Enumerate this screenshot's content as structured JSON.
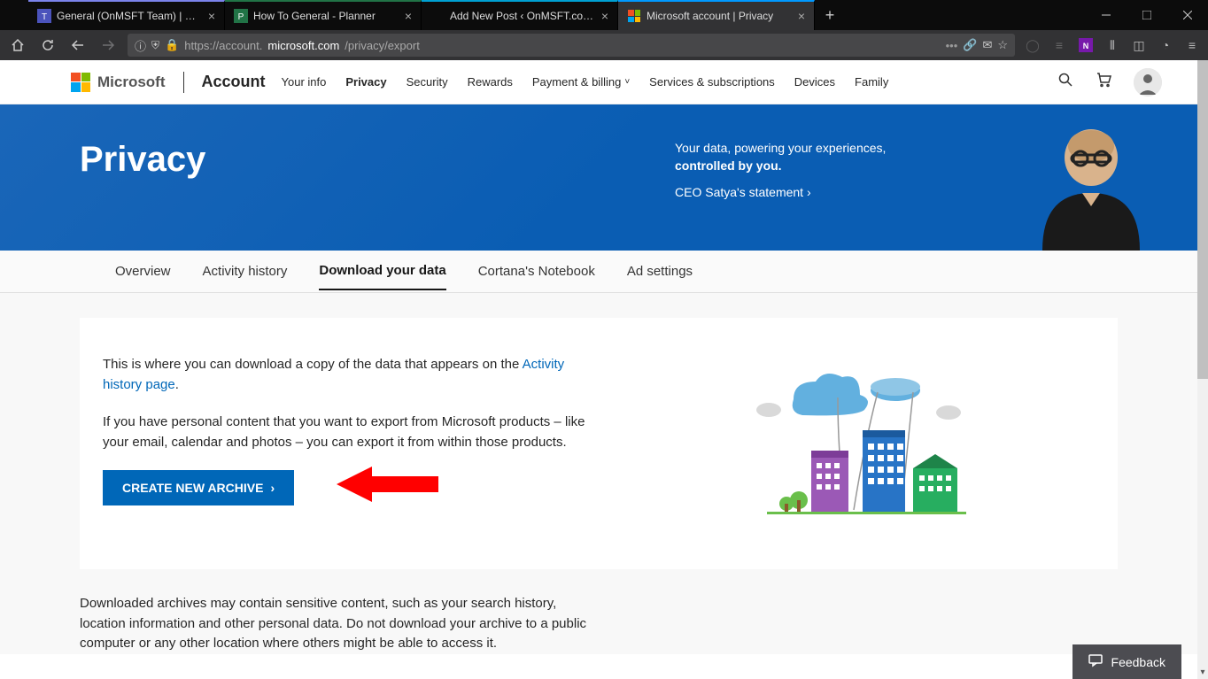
{
  "browser": {
    "tabs": [
      {
        "label": "General (OnMSFT Team) | Micro"
      },
      {
        "label": "How To General - Planner"
      },
      {
        "label": "Add New Post ‹ OnMSFT.com — W"
      },
      {
        "label": "Microsoft account | Privacy"
      }
    ],
    "url_pre": "https://account.",
    "url_host": "microsoft.com",
    "url_path": "/privacy/export"
  },
  "header": {
    "brand": "Microsoft",
    "crumb": "Account",
    "nav": {
      "your_info": "Your info",
      "privacy": "Privacy",
      "security": "Security",
      "rewards": "Rewards",
      "payment": "Payment & billing",
      "services": "Services & subscriptions",
      "devices": "Devices",
      "family": "Family"
    }
  },
  "hero": {
    "title": "Privacy",
    "tagline_a": "Your data, powering your experiences, ",
    "tagline_b": "controlled by you.",
    "stmt": "CEO Satya's statement"
  },
  "subnav": {
    "overview": "Overview",
    "activity": "Activity history",
    "download": "Download your data",
    "cortana": "Cortana's Notebook",
    "ads": "Ad settings"
  },
  "card": {
    "p1a": "This is where you can download a copy of the data that appears on the ",
    "p1link": "Activity history page",
    "p1b": ".",
    "p2": "If you have personal content that you want to export from Microsoft products – like your email, calendar and photos – you can export it from within those products.",
    "button": "CREATE NEW ARCHIVE"
  },
  "warn": "Downloaded archives may contain sensitive content, such as your search history, location information and other personal data. Do not download your archive to a public computer or any other location where others might be able to access it.",
  "feedback": "Feedback"
}
